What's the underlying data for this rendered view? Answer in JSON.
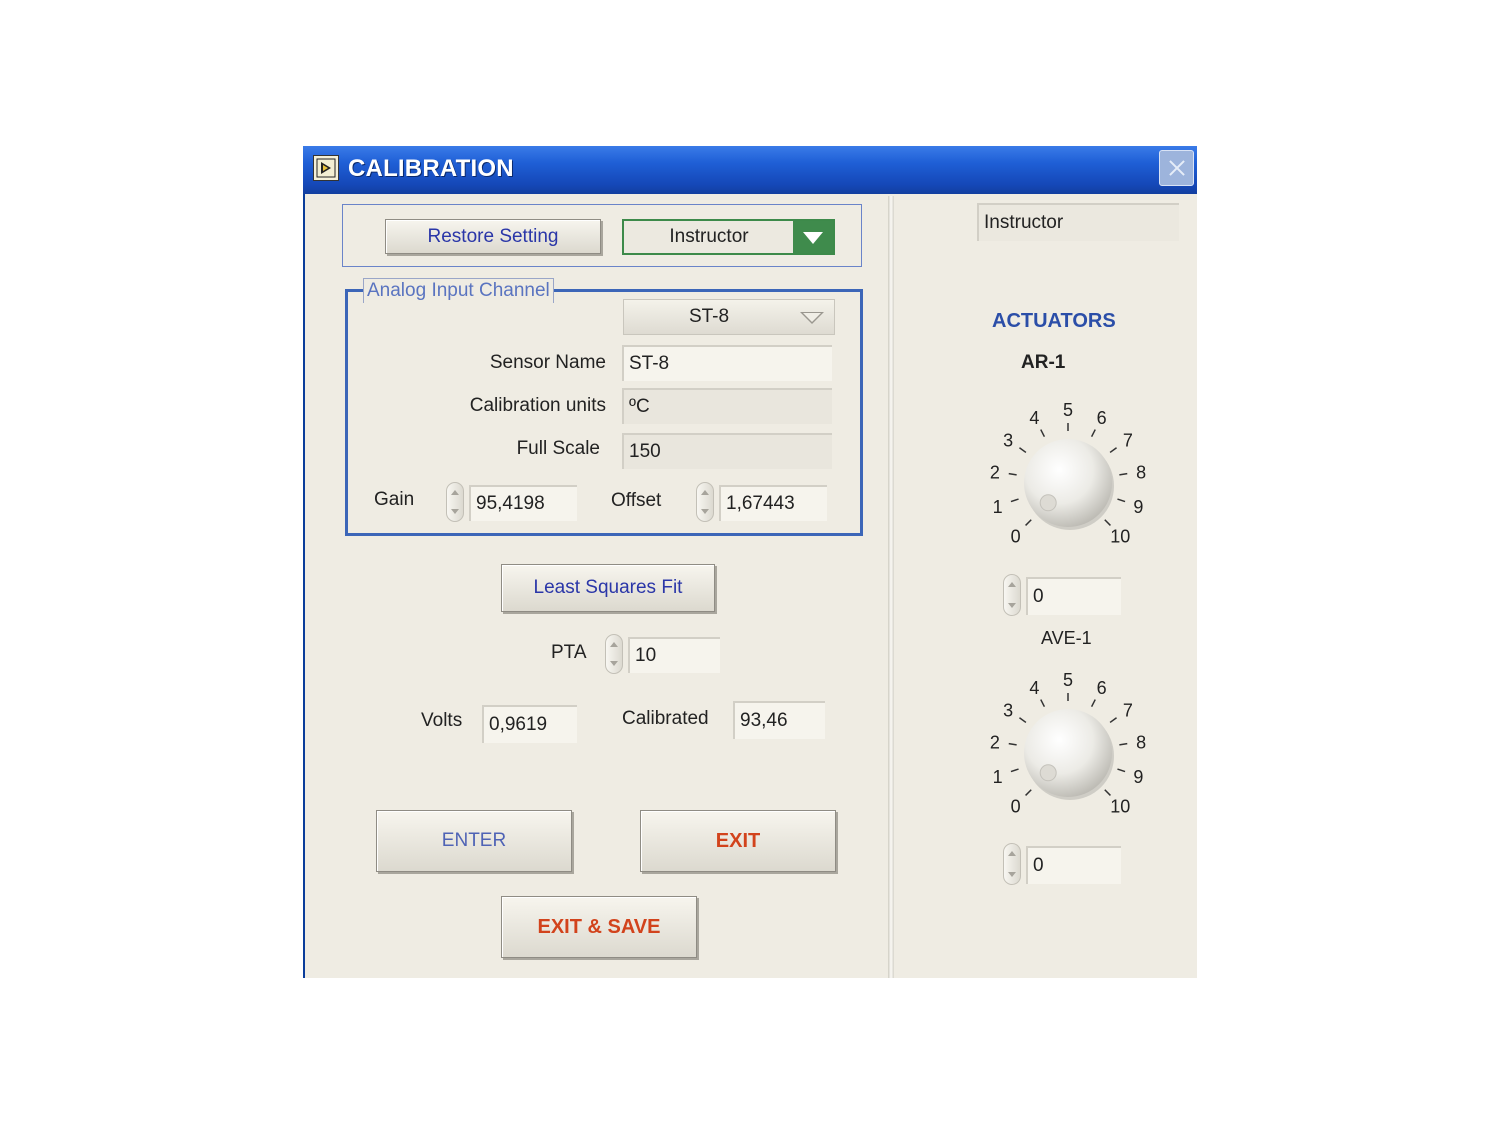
{
  "window": {
    "title": "CALIBRATION"
  },
  "toolbar": {
    "restore_label": "Restore Setting",
    "role_selected": "Instructor"
  },
  "analog_input": {
    "group_label": "Analog Input Channel",
    "channel_selected": "ST-8",
    "sensor_name_label": "Sensor Name",
    "sensor_name_value": "ST-8",
    "units_label": "Calibration units",
    "units_value": "ºC",
    "full_scale_label": "Full Scale",
    "full_scale_value": "150",
    "gain_label": "Gain",
    "gain_value": "95,4198",
    "offset_label": "Offset",
    "offset_value": "1,67443"
  },
  "fit": {
    "button_label": "Least Squares  Fit",
    "pta_label": "PTA",
    "pta_value": "10"
  },
  "readings": {
    "volts_label": "Volts",
    "volts_value": "0,9619",
    "calibrated_label": "Calibrated",
    "calibrated_value": "93,46"
  },
  "actions": {
    "enter_label": "ENTER",
    "exit_label": "EXIT",
    "exit_save_label": "EXIT & SAVE"
  },
  "right_panel": {
    "role_indicator": "Instructor",
    "section_title": "ACTUATORS",
    "knobs": [
      {
        "name": "AR-1",
        "value": "0",
        "scale": [
          "0",
          "1",
          "2",
          "3",
          "4",
          "5",
          "6",
          "7",
          "8",
          "9",
          "10"
        ]
      },
      {
        "name": "AVE-1",
        "value": "0",
        "scale": [
          "0",
          "1",
          "2",
          "3",
          "4",
          "5",
          "6",
          "7",
          "8",
          "9",
          "10"
        ]
      }
    ]
  },
  "colors": {
    "titlebar": "#1f5fd6",
    "panel_bg": "#efece3",
    "accent_blue": "#2b4ea8",
    "exit_red": "#d2431c",
    "select_green": "#3f8b4c"
  },
  "icons": {
    "app": "labview-vi-icon",
    "close": "close-icon",
    "dropdown": "triangle-down-icon",
    "spinner": "increment-decrement-icon"
  }
}
